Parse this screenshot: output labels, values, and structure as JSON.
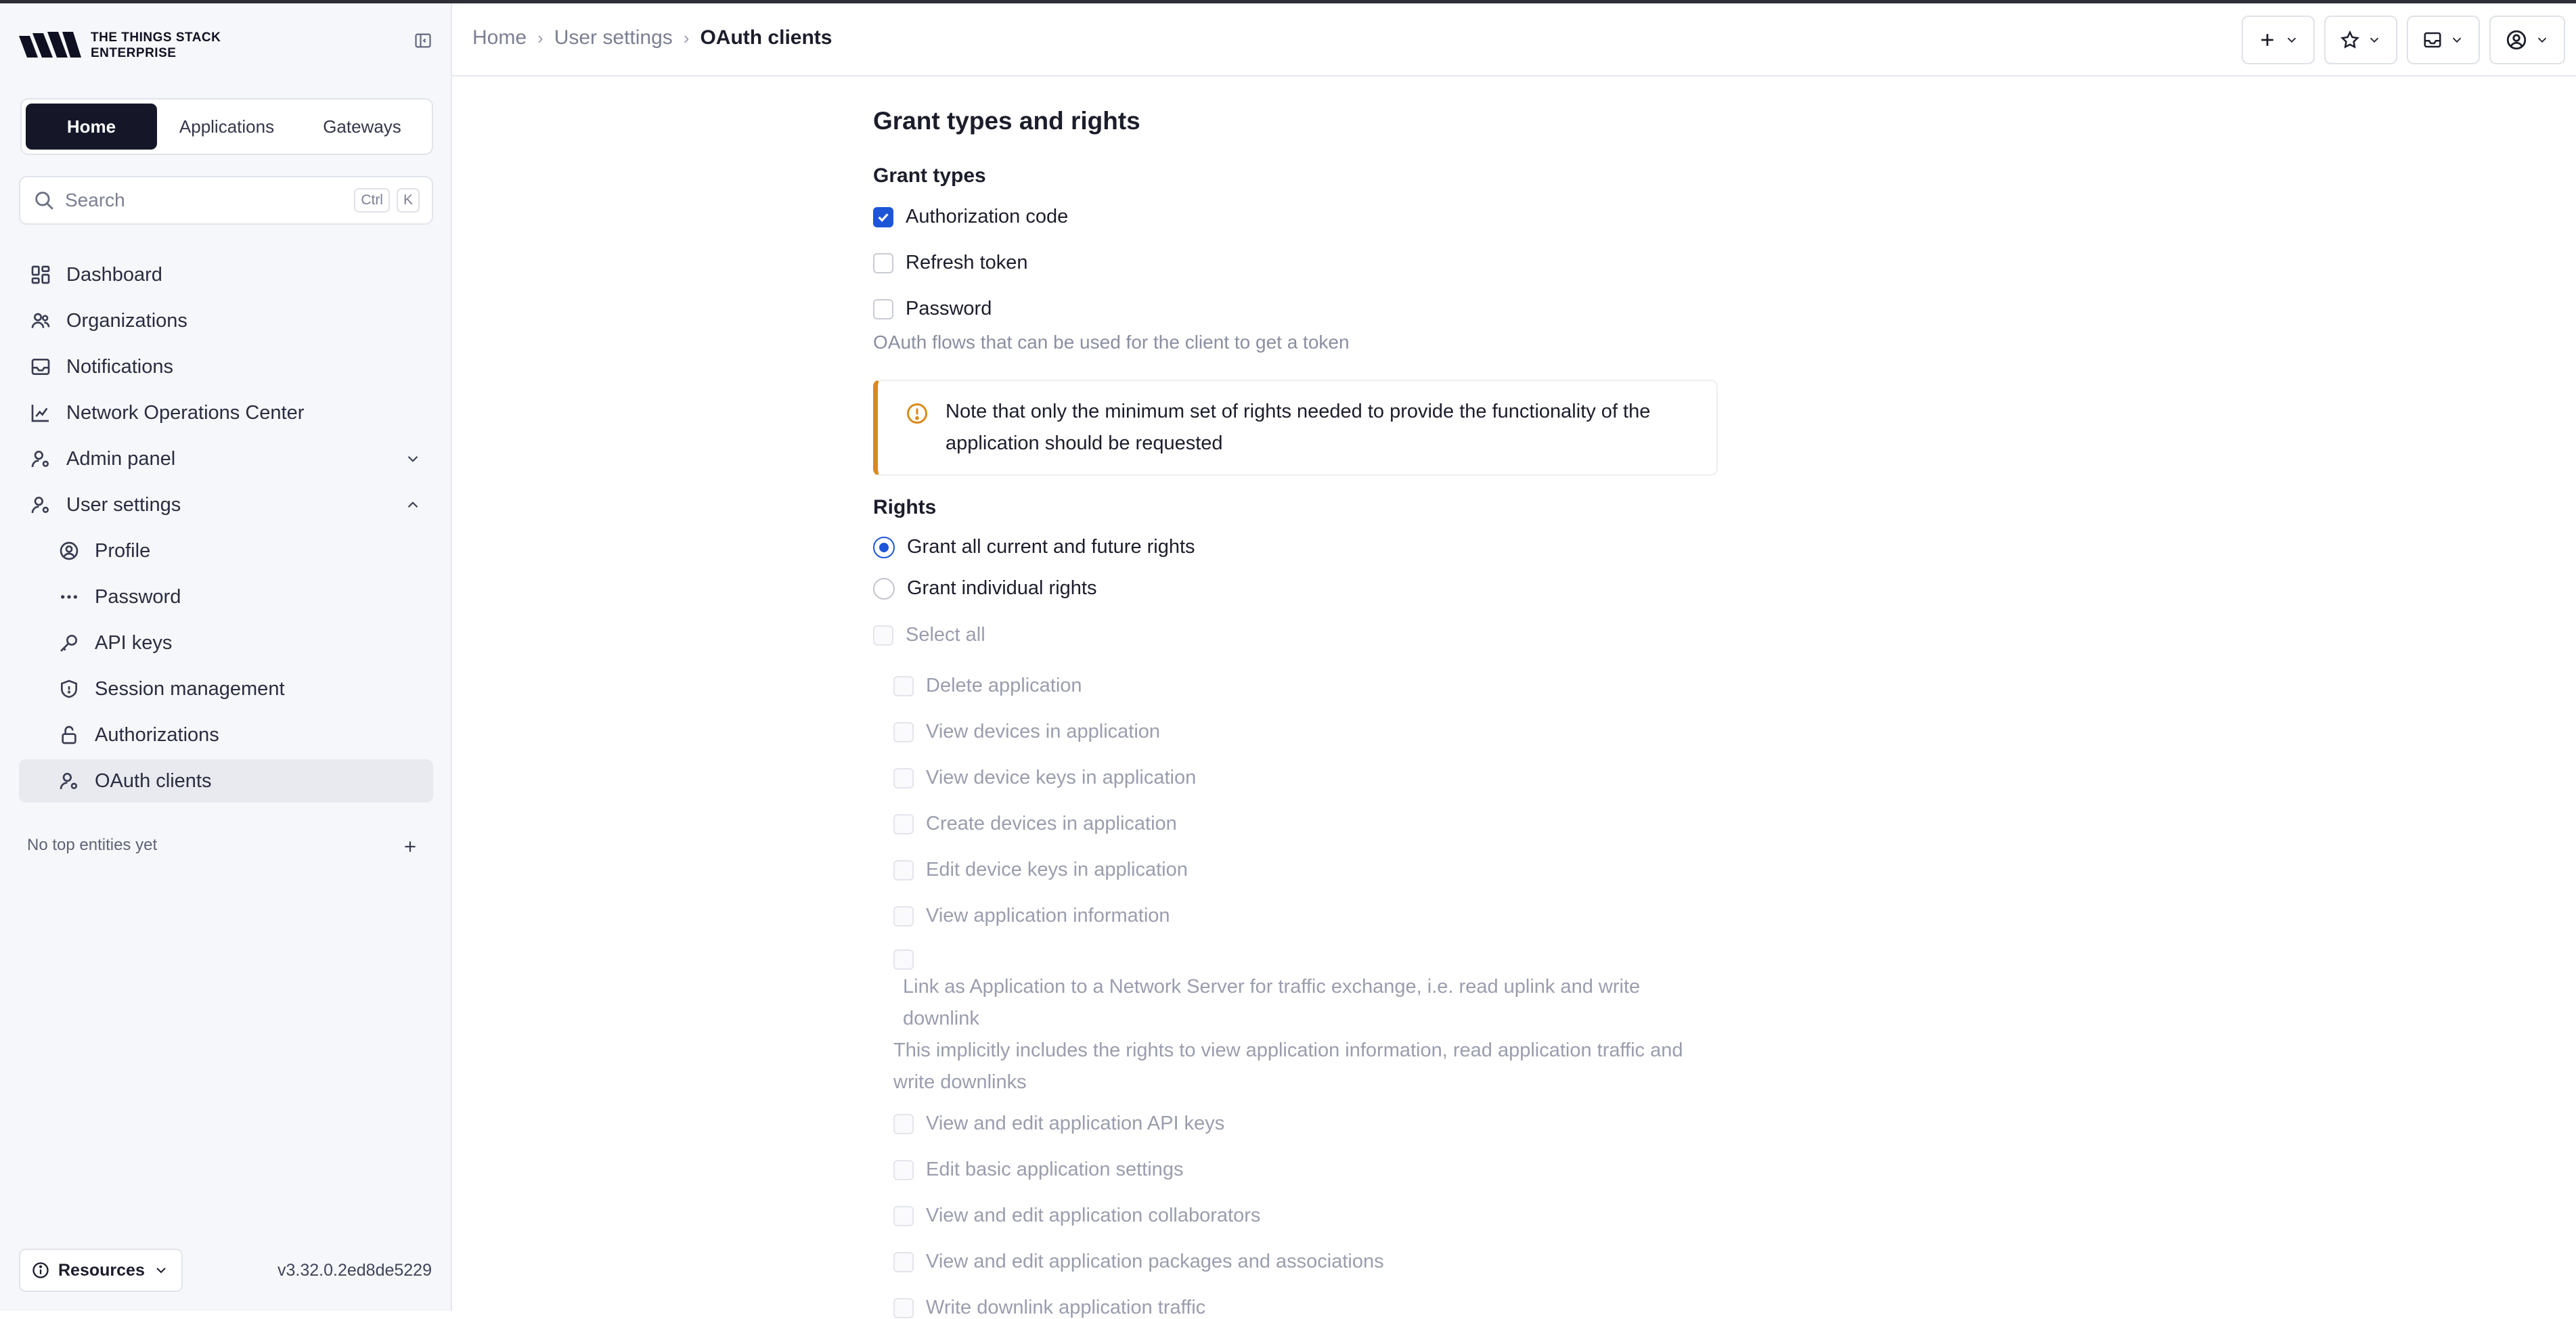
{
  "brand": {
    "line1": "THE THINGS STACK",
    "line2": "ENTERPRISE"
  },
  "switcher": {
    "home": "Home",
    "applications": "Applications",
    "gateways": "Gateways"
  },
  "search": {
    "placeholder": "Search",
    "kbd1": "Ctrl",
    "kbd2": "K"
  },
  "nav": {
    "dashboard": "Dashboard",
    "organizations": "Organizations",
    "notifications": "Notifications",
    "noc": "Network Operations Center",
    "admin_panel": "Admin panel",
    "user_settings": "User settings",
    "profile": "Profile",
    "password": "Password",
    "api_keys": "API keys",
    "session_management": "Session management",
    "authorizations": "Authorizations",
    "oauth_clients": "OAuth clients"
  },
  "top_entities": {
    "empty": "No top entities yet"
  },
  "footer": {
    "resources": "Resources",
    "version": "v3.32.0.2ed8de5229"
  },
  "breadcrumb": {
    "home": "Home",
    "user_settings": "User settings",
    "current": "OAuth clients"
  },
  "form": {
    "section_title": "Grant types and rights",
    "grant_types_label": "Grant types",
    "grant_types": [
      {
        "label": "Authorization code",
        "checked": true
      },
      {
        "label": "Refresh token",
        "checked": false
      },
      {
        "label": "Password",
        "checked": false
      }
    ],
    "grant_types_description": "OAuth flows that can be used for the client to get a token",
    "notice": "Note that only the minimum set of rights needed to provide the functionality of the application should be requested",
    "rights_label": "Rights",
    "rights_options": {
      "all": "Grant all current and future rights",
      "individual": "Grant individual rights"
    },
    "select_all": "Select all",
    "rights": [
      "Delete application",
      "View devices in application",
      "View device keys in application",
      "Create devices in application",
      "Edit device keys in application",
      "View application information"
    ],
    "link_right": "Link as Application to a Network Server for traffic exchange, i.e. read uplink and write downlink",
    "link_right_note": "This implicitly includes the rights to view application information, read application traffic and write downlinks",
    "rights_more": [
      "View and edit application API keys",
      "Edit basic application settings",
      "View and edit application collaborators",
      "View and edit application packages and associations",
      "Write downlink application traffic"
    ]
  }
}
